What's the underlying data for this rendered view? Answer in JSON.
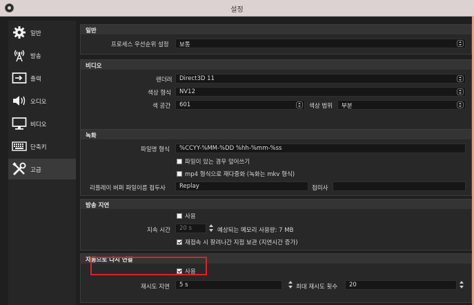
{
  "window": {
    "title": "설정"
  },
  "sidebar": {
    "items": [
      {
        "label": "일반",
        "icon": "gear-icon"
      },
      {
        "label": "방송",
        "icon": "broadcast-icon"
      },
      {
        "label": "출력",
        "icon": "output-icon"
      },
      {
        "label": "오디오",
        "icon": "speaker-icon"
      },
      {
        "label": "비디오",
        "icon": "monitor-icon"
      },
      {
        "label": "단축키",
        "icon": "keyboard-icon"
      },
      {
        "label": "고급",
        "icon": "tools-icon",
        "active": true
      }
    ]
  },
  "general": {
    "title": "일반",
    "priority_label": "프로세스 우선순위 설정",
    "priority_value": "보통"
  },
  "video": {
    "title": "비디오",
    "renderer_label": "렌더러",
    "renderer_value": "Direct3D 11",
    "color_format_label": "색상 형식",
    "color_format_value": "NV12",
    "color_space_label": "색 공간",
    "color_space_value": "601",
    "color_range_label": "색상 범위",
    "color_range_value": "부분"
  },
  "recording": {
    "title": "녹화",
    "filename_format_label": "파일명 형식",
    "filename_format_value": "%CCYY-%MM-%DD %hh-%mm-%ss",
    "overwrite_label": "파일이 있는 경우 덮어쓰기",
    "overwrite_checked": false,
    "mp4_remux_label": "mp4 형식으로 재다중화 (녹화는 mkv 형식)",
    "mp4_remux_checked": false,
    "replay_prefix_label": "리플레이 버퍼 파일이름 접두사",
    "replay_prefix_value": "Replay",
    "suffix_label": "접미사",
    "suffix_value": ""
  },
  "stream_delay": {
    "title": "방송 지연",
    "enable_label": "사용",
    "enable_checked": false,
    "duration_label": "지속 시간",
    "duration_value": "20 s",
    "memory_estimate": "예상되는 메모리 사용량: 7 MB",
    "preserve_label": "재접속 시 잘려나간 지점 보관 (지연시간 증가)",
    "preserve_checked": true
  },
  "auto_reconnect": {
    "title": "자동으로 다시 연결",
    "enable_label": "사용",
    "enable_checked": true,
    "retry_delay_label": "재시도 지연",
    "retry_delay_value": "5 s",
    "max_retries_label": "최대 재시도 횟수",
    "max_retries_value": "20"
  },
  "colors": {
    "highlight": "#d9232d",
    "titlebar": "#ddd2d2",
    "background": "#1f1f1f"
  }
}
